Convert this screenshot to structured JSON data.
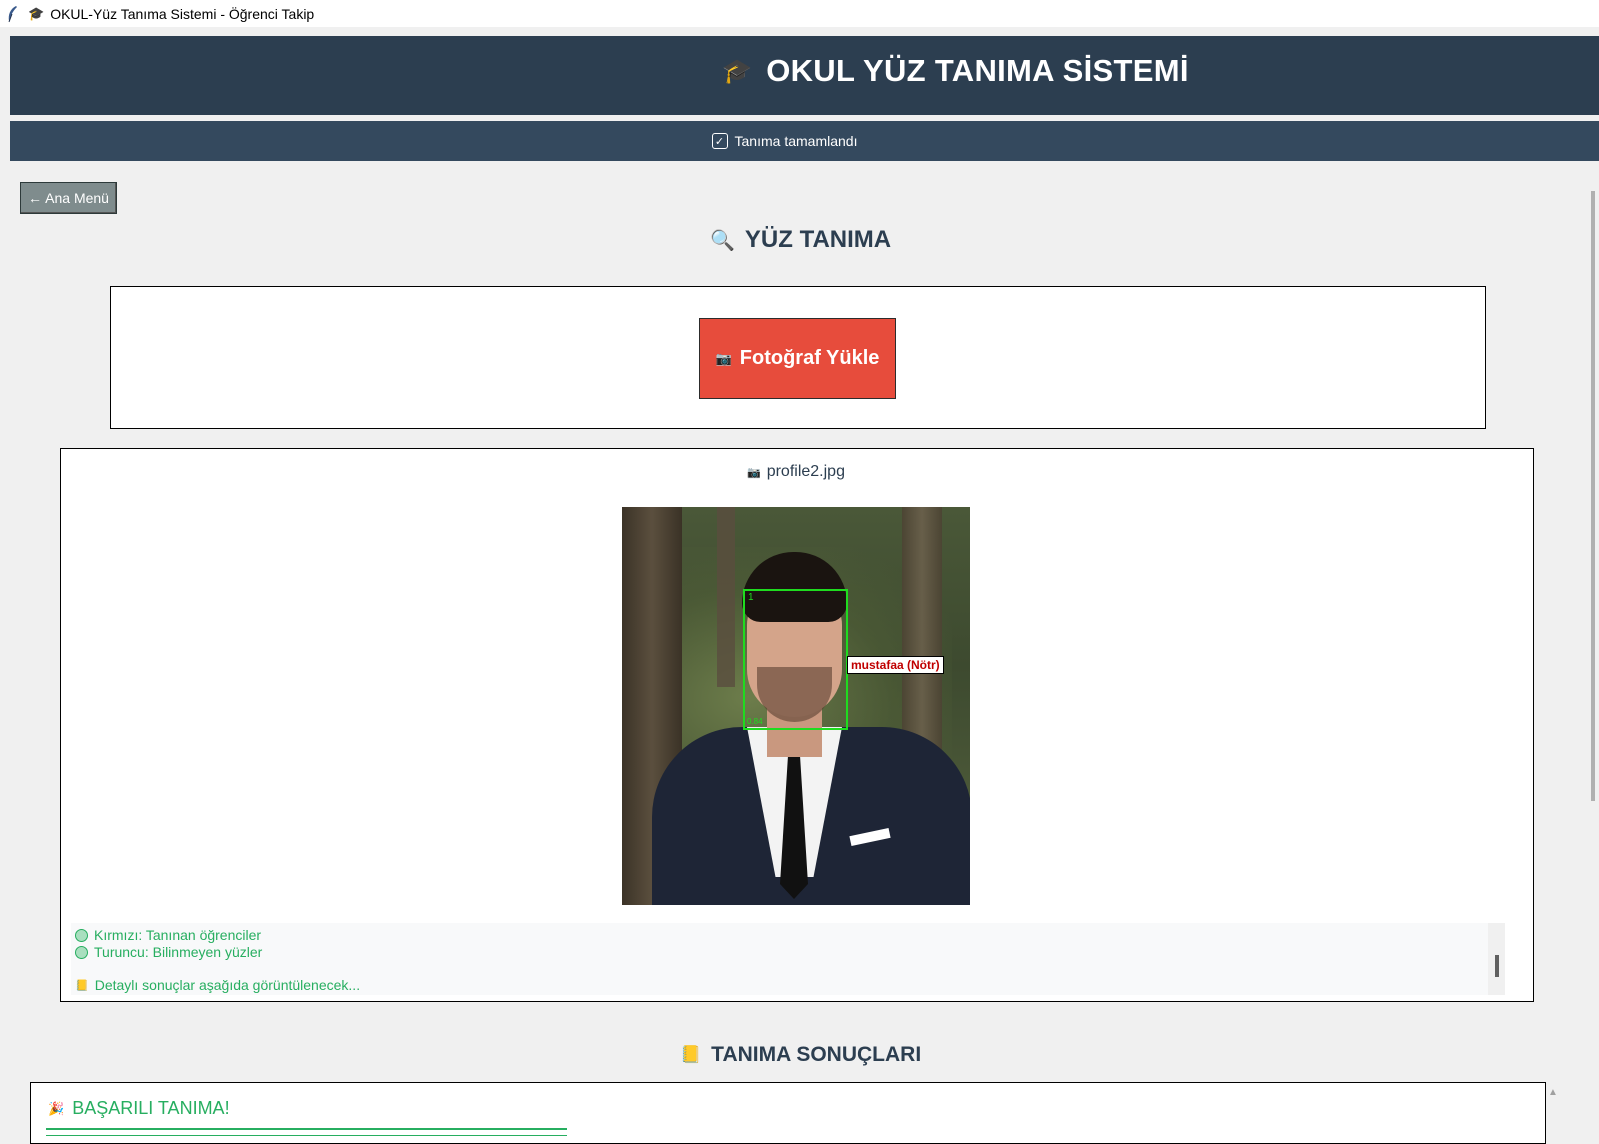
{
  "window": {
    "title": "OKUL-Yüz Tanıma Sistemi - Öğrenci Takip",
    "title_icon": "graduation-cap-icon",
    "app_icon": "feather-icon"
  },
  "header": {
    "icon": "graduation-cap-icon",
    "title": "OKUL YÜZ TANIMA SİSTEMİ",
    "background": "#2c3e50"
  },
  "status": {
    "icon": "checkbox-checked-icon",
    "text": "Tanıma tamamlandı",
    "background": "#34495e"
  },
  "nav": {
    "back_label": "← Ana Menü"
  },
  "recognition": {
    "title_icon": "magnifier-icon",
    "title": "YÜZ TANIMA",
    "upload_icon": "camera-icon",
    "upload_label": "Fotoğraf Yükle",
    "upload_color": "#e74c3c"
  },
  "preview": {
    "file_icon": "camera-icon",
    "filename": "profile2.jpg",
    "face_box": {
      "index": "1",
      "confidence": "0.84",
      "color": "#1fdc1f"
    },
    "label": "mustafaa (Nötr)"
  },
  "legend": {
    "items": [
      "Kırmızı: Tanınan öğrenciler",
      "Turuncu: Bilinmeyen yüzler"
    ],
    "details_icon": "notebook-icon",
    "details": "Detaylı sonuçlar aşağıda görüntülenecek...",
    "color": "#27ae60"
  },
  "results": {
    "title_icon": "notebook-icon",
    "title": "TANIMA SONUÇLARI",
    "success_icon": "party-popper-icon",
    "success_text": "BAŞARILI TANIMA!"
  }
}
